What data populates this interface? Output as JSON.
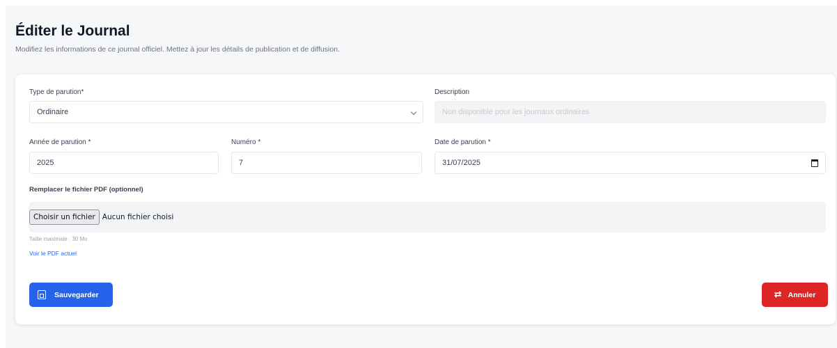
{
  "header": {
    "title": "Éditer le Journal",
    "subtitle": "Modifiez les informations de ce journal officiel. Mettez à jour les détails de publication et de diffusion."
  },
  "form": {
    "type_label": "Type de parution*",
    "type_value": "Ordinaire",
    "description_label": "Description",
    "description_placeholder": "Non disponible pour les journaux ordinaires",
    "year_label": "Année de parution *",
    "year_value": "2025",
    "number_label": "Numéro *",
    "number_value": "7",
    "date_label": "Date de parution *",
    "date_value": "31/07/2025",
    "pdf_label": "Remplacer le fichier PDF (optionnel)",
    "file_button": "Choisir un fichier",
    "file_status": "Aucun fichier choisi",
    "max_size_hint": "Taille maximale : 30 Mo",
    "view_pdf_link": "Voir le PDF actuel"
  },
  "actions": {
    "save_label": "Sauvegarder",
    "cancel_label": "Annuler",
    "save_color": "#2563eb",
    "cancel_color": "#dc2626"
  },
  "icons": {
    "select": "chevron-down-icon",
    "date": "calendar-icon",
    "save": "save-icon",
    "cancel": "return-arrow-icon"
  }
}
